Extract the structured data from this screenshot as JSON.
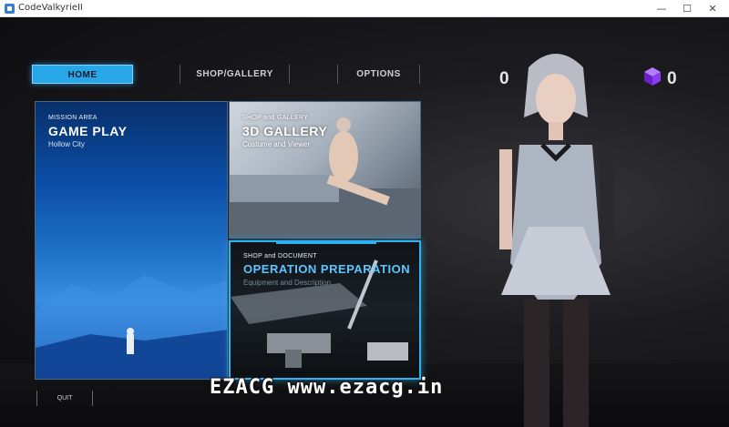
{
  "window": {
    "title": "CodeValkyrieII",
    "min_glyph": "—",
    "max_glyph": "☐",
    "close_glyph": "✕"
  },
  "nav": {
    "home": "HOME",
    "shop_gallery": "SHOP/GALLERY",
    "options": "OPTIONS"
  },
  "currency": {
    "primary_value": "0",
    "gem_value": "0",
    "gem_icon": "purple-cube-icon",
    "gem_color": "#8a3cf0"
  },
  "panels": {
    "gameplay": {
      "small": "MISSION AREA",
      "title": "GAME PLAY",
      "sub": "Hollow City"
    },
    "gallery": {
      "small": "SHOP and GALLERY",
      "title": "3D GALLERY",
      "sub": "Costume and Viewer"
    },
    "operation": {
      "small": "SHOP and DOCUMENT",
      "title": "OPERATION PREPARATION",
      "sub": "Equipment and Description"
    }
  },
  "quit": "QUIT",
  "watermark": "EZACG www.ezacg.in",
  "colors": {
    "accent": "#27a6e8",
    "selected_border": "#2fb3f0"
  }
}
